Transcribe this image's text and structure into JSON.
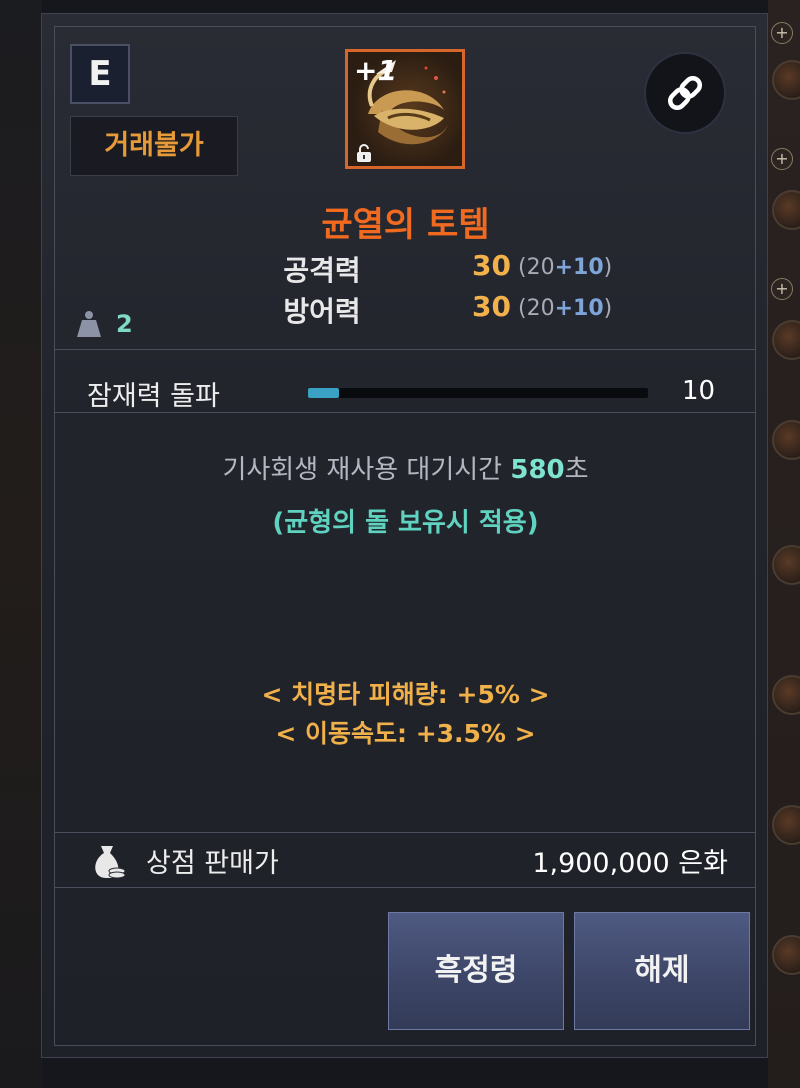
{
  "tooltip": {
    "grade": "E",
    "trade_status": "거래불가",
    "item_enhance": "+1",
    "item_name": "균열의 토템",
    "stats": [
      {
        "label": "공격력",
        "value": "30",
        "base": "20",
        "bonus": "10"
      },
      {
        "label": "방어력",
        "value": "30",
        "base": "20",
        "bonus": "10"
      }
    ],
    "weight": "2",
    "potential": {
      "label": "잠재력 돌파",
      "value": "10",
      "fill_fraction": 0.09
    },
    "cooldown": {
      "text": "기사회생 재사용 대기시간",
      "seconds": "580",
      "unit": "초"
    },
    "condition": "(균형의 돌 보유시 적용)",
    "bonuses": [
      "< 치명타 피해량: +5% >",
      "< 이동속도: +3.5% >"
    ],
    "price": {
      "label": "상점 판매가",
      "value": "1,900,000 은화"
    },
    "buttons": {
      "left": "흑정령",
      "right": "해제"
    }
  },
  "colors": {
    "item_name": "#f06a20",
    "trade_tag": "#e69a38",
    "bonus_text": "#f0b04a",
    "highlight_teal": "#5fd3c0"
  },
  "icons": [
    "link-icon",
    "lock-icon",
    "weight-icon",
    "money-bag-icon"
  ]
}
